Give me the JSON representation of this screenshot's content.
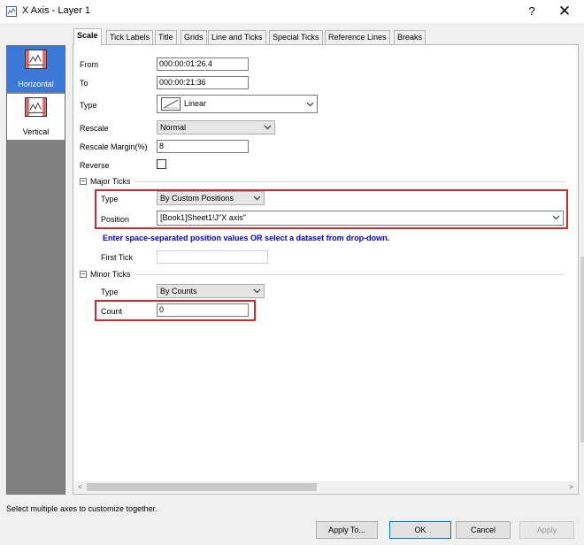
{
  "window": {
    "title": "X Axis - Layer 1",
    "help_label": "?",
    "close_label": "✕"
  },
  "sidebar": {
    "items": [
      {
        "label": "Horizontal",
        "icon": "horizontal-axis-icon",
        "selected": true
      },
      {
        "label": "Vertical",
        "icon": "vertical-axis-icon",
        "selected": false
      }
    ]
  },
  "tabs": [
    {
      "label": "Scale",
      "active": true
    },
    {
      "label": "Tick Labels"
    },
    {
      "label": "Title"
    },
    {
      "label": "Grids"
    },
    {
      "label": "Line and Ticks"
    },
    {
      "label": "Special Ticks"
    },
    {
      "label": "Reference Lines"
    },
    {
      "label": "Breaks"
    }
  ],
  "scale": {
    "from_label": "From",
    "from_value": "000:00:01:26.4",
    "to_label": "To",
    "to_value": "000:00:21:36",
    "type_label": "Type",
    "type_value": "Linear",
    "rescale_label": "Rescale",
    "rescale_value": "Normal",
    "margin_label": "Rescale Margin(%)",
    "margin_value": "8",
    "reverse_label": "Reverse",
    "reverse_checked": false
  },
  "major_ticks": {
    "section_label": "Major Ticks",
    "collapse_glyph": "−",
    "type_label": "Type",
    "type_value": "By Custom Positions",
    "position_label": "Position",
    "position_value": "[Book1]Sheet1!J\"X axis\"",
    "hint": "Enter space-separated position values OR select a dataset from drop-down.",
    "first_tick_label": "First Tick",
    "first_tick_value": ""
  },
  "minor_ticks": {
    "section_label": "Minor Ticks",
    "collapse_glyph": "−",
    "type_label": "Type",
    "type_value": "By Counts",
    "count_label": "Count",
    "count_value": "0"
  },
  "scrollbar": {
    "left_glyph": "<",
    "right_glyph": ">"
  },
  "status_text": "Select multiple axes to customize together.",
  "buttons": {
    "apply_to": "Apply To...",
    "ok": "OK",
    "cancel": "Cancel",
    "apply": "Apply"
  },
  "colors": {
    "highlight_box": "#d02828",
    "hint_text": "#0000e0",
    "selected_item": "#3c78d8"
  }
}
